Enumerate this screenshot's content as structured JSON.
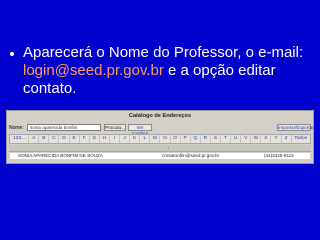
{
  "slide": {
    "text_before": "Aparecerá o Nome do Professor, o e-mail:",
    "email": "login@seed.pr.gov.br",
    "text_after": " e a opção editar contato."
  },
  "catalog": {
    "title": "Catálogo de Endereços",
    "search_label": "Nome:",
    "search_value": "sonia aparecida bonfim",
    "search_button": "Procura...",
    "show_cards_button": "Ver Cartões",
    "import_export_button": "Importar/Exportar",
    "letters": [
      "123...",
      "A",
      "B",
      "C",
      "D",
      "E",
      "F",
      "G",
      "H",
      "I",
      "J",
      "K",
      "L",
      "M",
      "N",
      "O",
      "P",
      "Q",
      "R",
      "S",
      "T",
      "U",
      "V",
      "W",
      "X",
      "Y",
      "Z",
      "Todos"
    ],
    "sort_indicator": "↑",
    "row": {
      "name": "SONIA APARECIDA BONFIM DE SOUZA",
      "email": "contatonfim@seed.pr.gov.br",
      "phone": "(44)3425-6115"
    }
  }
}
